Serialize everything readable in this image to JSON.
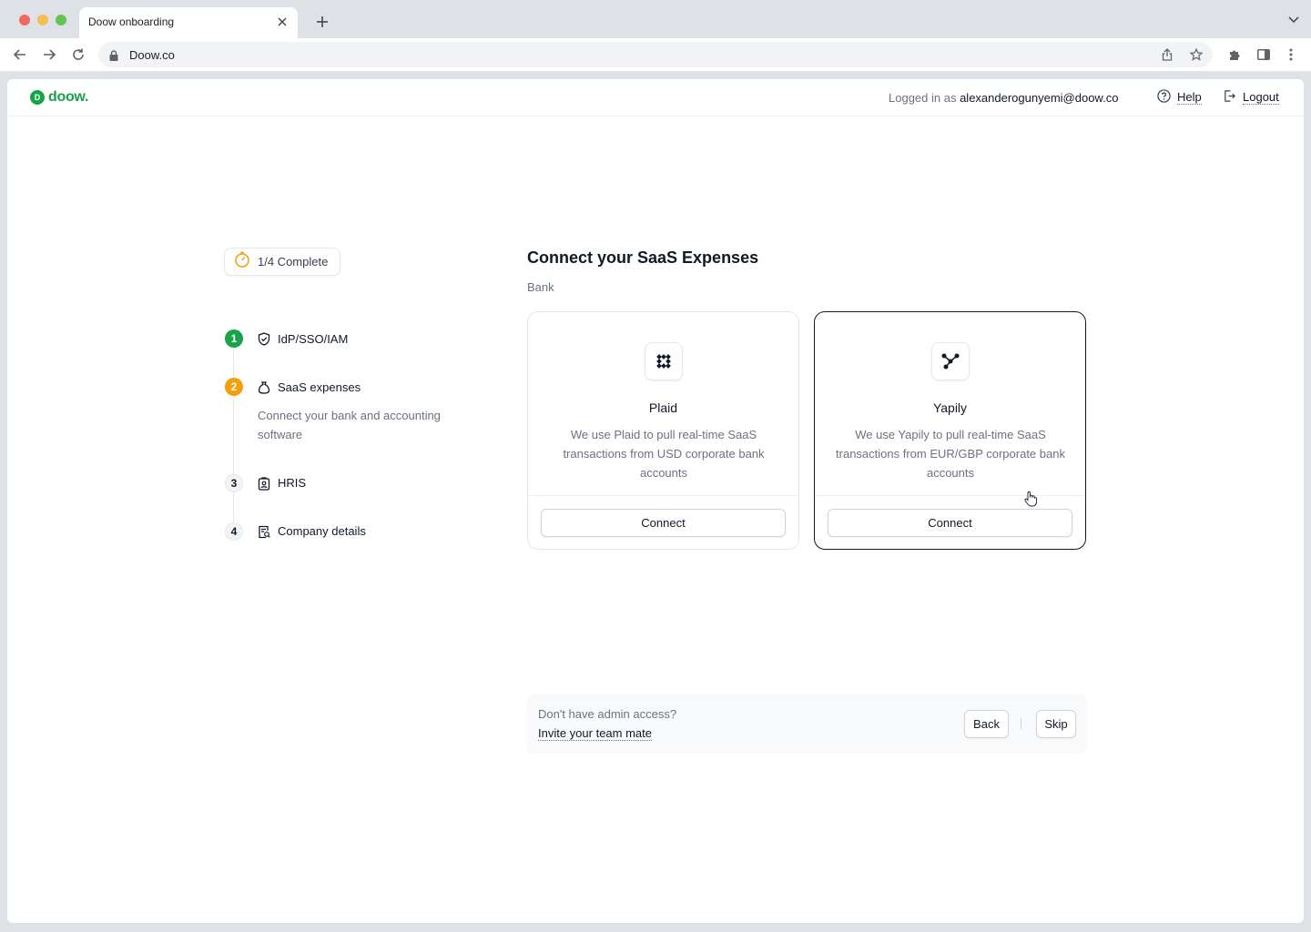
{
  "browser": {
    "tab_title": "Doow onboarding",
    "url": "Doow.co"
  },
  "app": {
    "logo_text": "doow.",
    "logged_in_prefix": "Logged in as",
    "logged_in_email": "alexanderogunyemi@doow.co",
    "help_label": "Help",
    "logout_label": "Logout"
  },
  "progress": {
    "label": "1/4 Complete",
    "completed_steps": 1,
    "total_steps": 4
  },
  "steps": [
    {
      "number": "1",
      "label": "IdP/SSO/IAM",
      "status": "done",
      "icon": "shield-check-icon"
    },
    {
      "number": "2",
      "label": "SaaS expenses",
      "status": "current",
      "icon": "money-bag-icon",
      "description": "Connect your bank and accounting software"
    },
    {
      "number": "3",
      "label": "HRIS",
      "status": "todo",
      "icon": "id-badge-icon"
    },
    {
      "number": "4",
      "label": "Company details",
      "status": "todo",
      "icon": "receipt-search-icon"
    }
  ],
  "main": {
    "title": "Connect your SaaS Expenses",
    "subtitle": "Bank",
    "cards": [
      {
        "name": "Plaid",
        "description": "We use Plaid to pull real-time SaaS transactions from USD corporate bank accounts",
        "button": "Connect",
        "icon": "plaid-logo-icon",
        "selected": false
      },
      {
        "name": "Yapily",
        "description": "We use Yapily to pull real-time SaaS transactions from EUR/GBP corporate bank accounts",
        "button": "Connect",
        "icon": "yapily-logo-icon",
        "selected": true
      }
    ]
  },
  "footer": {
    "question": "Don't have admin access?",
    "invite_link": "Invite your team mate",
    "back_label": "Back",
    "skip_label": "Skip"
  },
  "colors": {
    "brand": "#16a34a",
    "step_current": "#f59e0b",
    "selected_border": "#111827"
  }
}
